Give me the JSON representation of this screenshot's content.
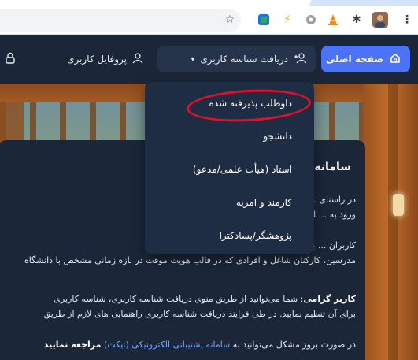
{
  "navbar": {
    "home_label": "صفحه اصلی",
    "get_id_label": "دریافت شناسه کاربری",
    "profile_label": "پروفایل کاربری"
  },
  "dropdown": {
    "items": [
      "داوطلب پذیرفته شده",
      "دانشجو",
      "استاد (هیأت علمی/مدعو)",
      "کارمند و امریه",
      "پژوهشگر/پسادکترا"
    ]
  },
  "card": {
    "title": "سامانه",
    "p1_l1": "در راستای ... کاربران در سامانه های مختلف دانشگاه",
    "p1_l2": "ورود به ... این شناسه را دریافت نمایند.",
    "p2_l1": "کاربران ... به تحصیل، دانش‌آموختگان، داوطلبان",
    "p2_l2": "مدرسین، کارکنان شاغل و افرادی که در قالب هویت موقت در بازه زمانی مشخص با دانشگاه",
    "p3_bold": "کاربر گرامی",
    "p3_l1": "شما می‌توانید از طریق منوی دریافت شناسه کاربری، شناسه کاربری",
    "p3_l2": "برای آن تنظیم نمایید. در طی فرایند دریافت شناسه کاربری راهنمایی های لازم از طریق",
    "p4_prefix": "در صورت بروز مشکل می‌توانید به",
    "p4_link": "سامانه پشتیبانی الکترونیکی (تیکت)",
    "p4_suffix": "مراجعه نمایید"
  },
  "colors": {
    "navbar_bg": "#1b2739",
    "home_button": "#4c72f5",
    "highlight": "#e0102a",
    "link": "#7aa2ff"
  },
  "icons": [
    "star-icon",
    "extension-icon",
    "bolt-icon",
    "shield-icon",
    "vlc-icon",
    "puzzle-icon",
    "avatar",
    "menu-icon",
    "home-icon",
    "user-add-icon",
    "user-icon",
    "lock-icon",
    "chevron-down-icon"
  ]
}
